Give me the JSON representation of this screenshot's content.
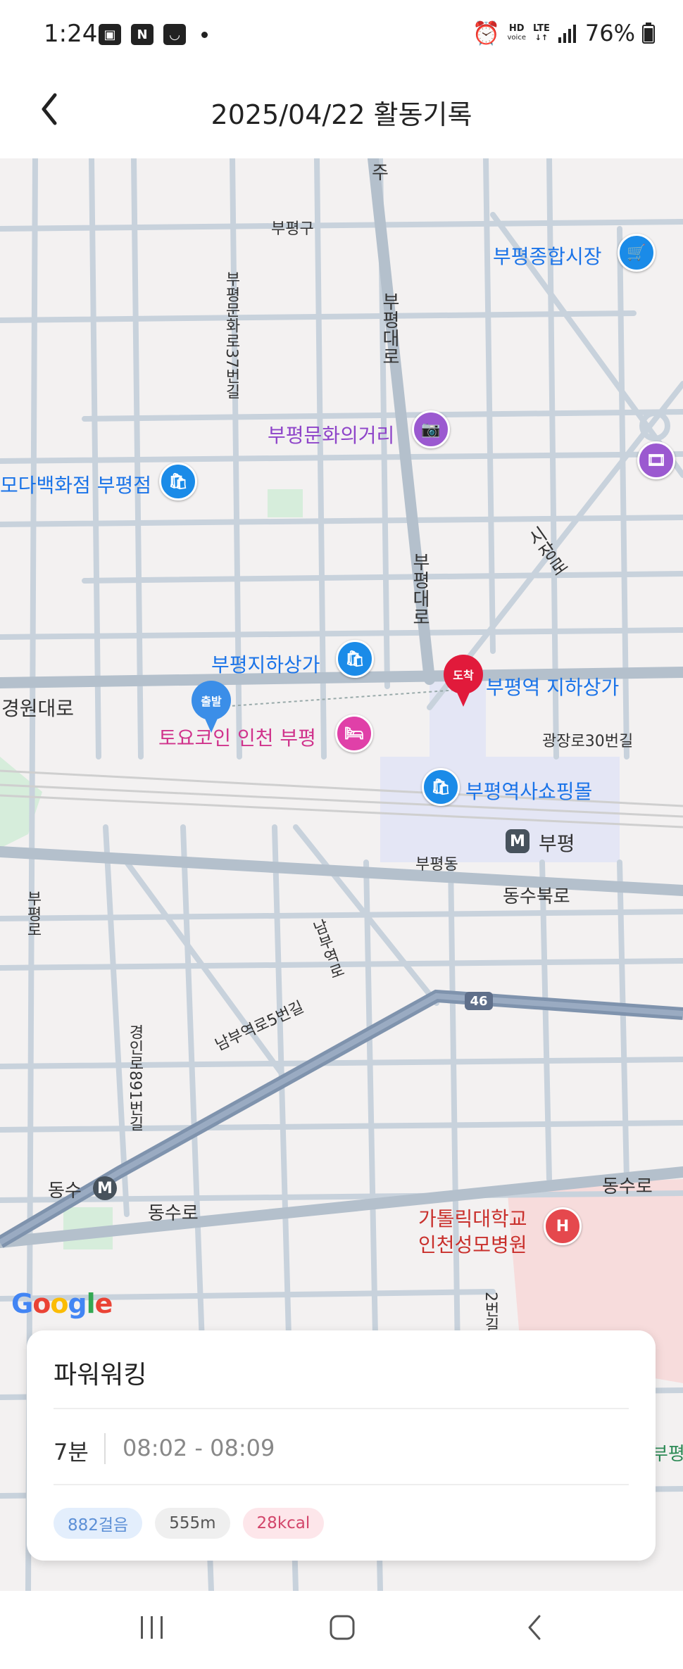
{
  "status_bar": {
    "time": "1:24",
    "network_hd": "HD",
    "network_voice": "voice",
    "network_lte": "LTE",
    "battery": "76%",
    "notif_icons": [
      "image-icon",
      "naver-icon",
      "shopping-icon"
    ]
  },
  "header": {
    "title": "2025/04/22 활동기록"
  },
  "map": {
    "labels": {
      "bupyeong_gu": "부평구",
      "bupyeong_market": "부평종합시장",
      "bupyeong_culture_street": "부평문화의거리",
      "lotte_dept": "모다백화점 부평점",
      "underground_mall": "부평지하상가",
      "station_underground": "부평역 지하상가",
      "gyeongwon_daero": "경원대로",
      "toyoko_inn": "토요코인 인천 부평",
      "gwangjang_ro": "광장로30번길",
      "station_shopping": "부평역사쇼핑몰",
      "bupyeong_station": "부평",
      "bupyeong_dong": "부평동",
      "dongsu_bukro": "동수북로",
      "bupyeong_daero_top": "부평대로",
      "bupyeong_daero_mid": "부평대로",
      "munhwa_ro": "부평문화로37번길",
      "sijang_ro": "시장로",
      "bupyeong_ro": "부평로",
      "nambu_yeokro": "남부역로",
      "nambu_5": "남부역로5번길",
      "gyeongin_891": "경인로891번길",
      "dongsu": "동수",
      "dongsu_ro_left": "동수로",
      "dongsu_ro_right": "동수로",
      "hospital_line1": "가톨릭대학교",
      "hospital_line2": "인천성모병원",
      "partial_right": "부평",
      "road_46": "46",
      "road_partial": "2번길",
      "road_partial_top": "주"
    },
    "pins": {
      "start": "출발",
      "end": "도착"
    },
    "metro_letter": "M",
    "hospital_letter": "H",
    "google_logo": "Google"
  },
  "activity_card": {
    "title": "파워워킹",
    "duration": "7분",
    "time_range": "08:02 - 08:09",
    "chips": {
      "steps": "882걸음",
      "distance": "555m",
      "calories": "28kcal"
    }
  }
}
